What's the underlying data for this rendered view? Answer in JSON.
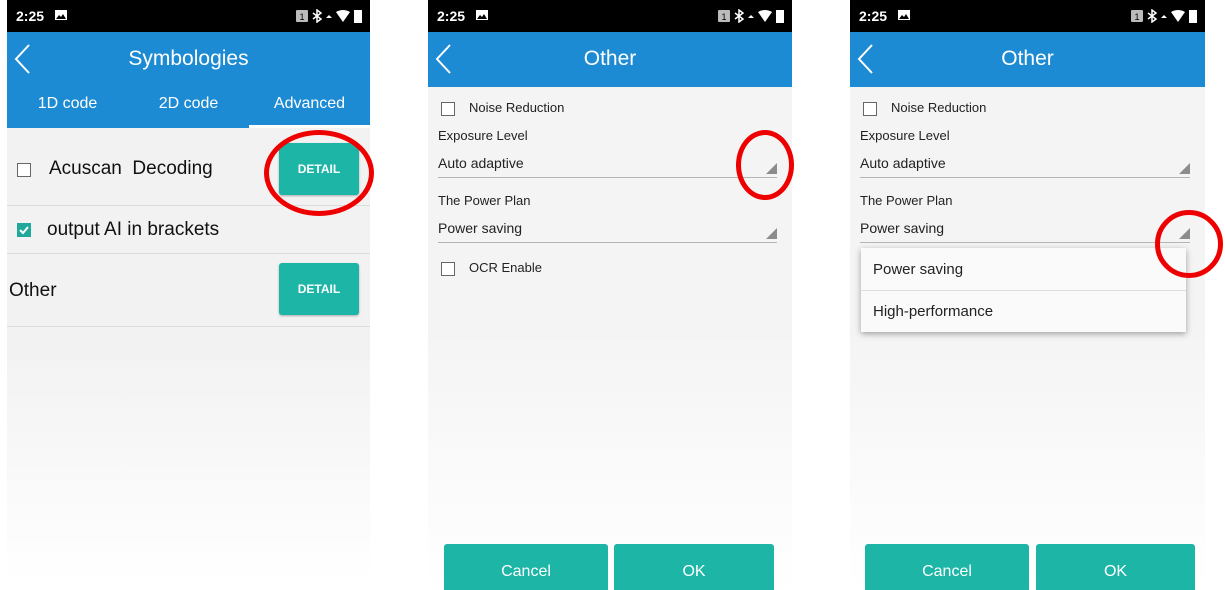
{
  "status_bar": {
    "time": "2:25",
    "sim_label": "1"
  },
  "screen1": {
    "title": "Symbologies",
    "tabs": [
      "1D code",
      "2D code",
      "Advanced"
    ],
    "rows": [
      {
        "label": "Acuscan  Decoding",
        "checked": false,
        "button": "DETAIL"
      },
      {
        "label": "output AI in brackets",
        "checked": true
      },
      {
        "label": "Other",
        "button": "DETAIL"
      }
    ]
  },
  "screen2": {
    "title": "Other",
    "noise_reduction": "Noise Reduction",
    "exposure_label": "Exposure Level",
    "exposure_value": "Auto adaptive",
    "power_label": "The Power Plan",
    "power_value": "Power saving",
    "ocr_label": "OCR Enable",
    "cancel": "Cancel",
    "ok": "OK"
  },
  "screen3": {
    "title": "Other",
    "noise_reduction": "Noise Reduction",
    "exposure_label": "Exposure Level",
    "exposure_value": "Auto adaptive",
    "power_label": "The Power Plan",
    "power_value": "Power saving",
    "dropdown_options": [
      "Power saving",
      "High-performance"
    ],
    "cancel": "Cancel",
    "ok": "OK"
  },
  "colors": {
    "appbar": "#1d8bd3",
    "button": "#1cb5a6",
    "highlight": "#ee0000",
    "checkbox_checked": "#1fa89b"
  }
}
